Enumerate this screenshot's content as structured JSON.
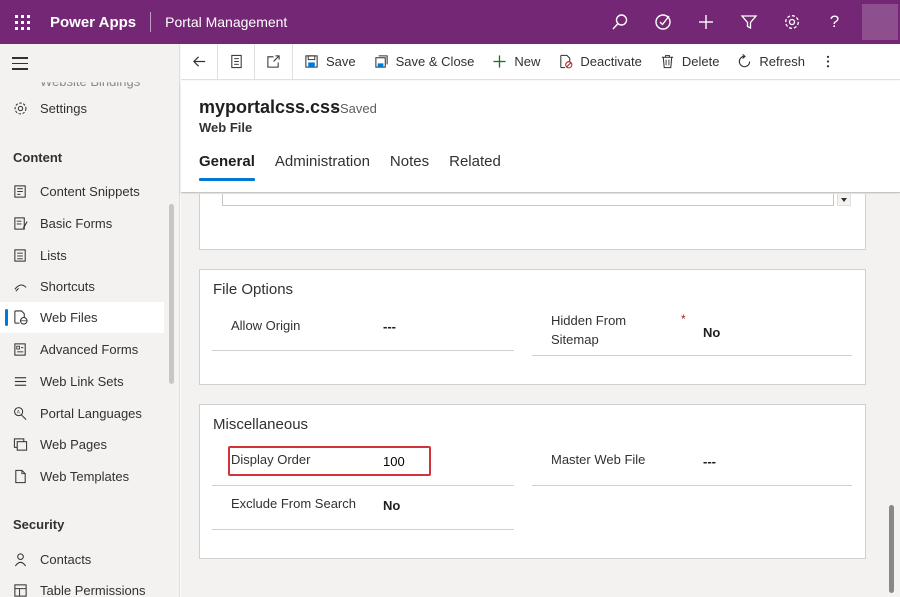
{
  "topbar": {
    "app_name": "Power Apps",
    "environment": "Portal Management",
    "icons": [
      "search-icon",
      "assistant-icon",
      "add-icon",
      "filter-icon",
      "settings-icon",
      "help-icon"
    ],
    "help_glyph": "?"
  },
  "sidebar": {
    "faded_item": "Website Bindings",
    "settings": "Settings",
    "content_header": "Content",
    "content_items": [
      {
        "label": "Content Snippets",
        "icon": "snippet-icon"
      },
      {
        "label": "Basic Forms",
        "icon": "form-icon"
      },
      {
        "label": "Lists",
        "icon": "list-icon"
      },
      {
        "label": "Shortcuts",
        "icon": "shortcut-icon"
      },
      {
        "label": "Web Files",
        "icon": "web-file-icon",
        "active": true
      },
      {
        "label": "Advanced Forms",
        "icon": "advanced-form-icon"
      },
      {
        "label": "Web Link Sets",
        "icon": "link-set-icon"
      },
      {
        "label": "Portal Languages",
        "icon": "language-icon"
      },
      {
        "label": "Web Pages",
        "icon": "web-page-icon"
      },
      {
        "label": "Web Templates",
        "icon": "template-icon"
      }
    ],
    "security_header": "Security",
    "security_items": [
      {
        "label": "Contacts",
        "icon": "contact-icon"
      },
      {
        "label": "Table Permissions",
        "icon": "permission-icon"
      }
    ]
  },
  "commands": {
    "save": "Save",
    "save_close": "Save & Close",
    "new": "New",
    "deactivate": "Deactivate",
    "delete": "Delete",
    "refresh": "Refresh"
  },
  "record": {
    "title": "myportalcss.css",
    "status": "- Saved",
    "entity": "Web File"
  },
  "tabs": [
    "General",
    "Administration",
    "Notes",
    "Related"
  ],
  "active_tab": "General",
  "sections": {
    "file_options": {
      "title": "File Options",
      "allow_origin_label": "Allow Origin",
      "allow_origin_value": "---",
      "hidden_label_1": "Hidden From",
      "hidden_label_2": "Sitemap",
      "hidden_required": "*",
      "hidden_value": "No"
    },
    "misc": {
      "title": "Miscellaneous",
      "display_order_label": "Display Order",
      "display_order_value": "100",
      "master_label": "Master Web File",
      "master_value": "---",
      "exclude_label": "Exclude From Search",
      "exclude_value": "No"
    }
  },
  "colors": {
    "brand": "#742774",
    "accent": "#0078d4",
    "highlight": "#d13438",
    "new_icon": "#107c10"
  }
}
